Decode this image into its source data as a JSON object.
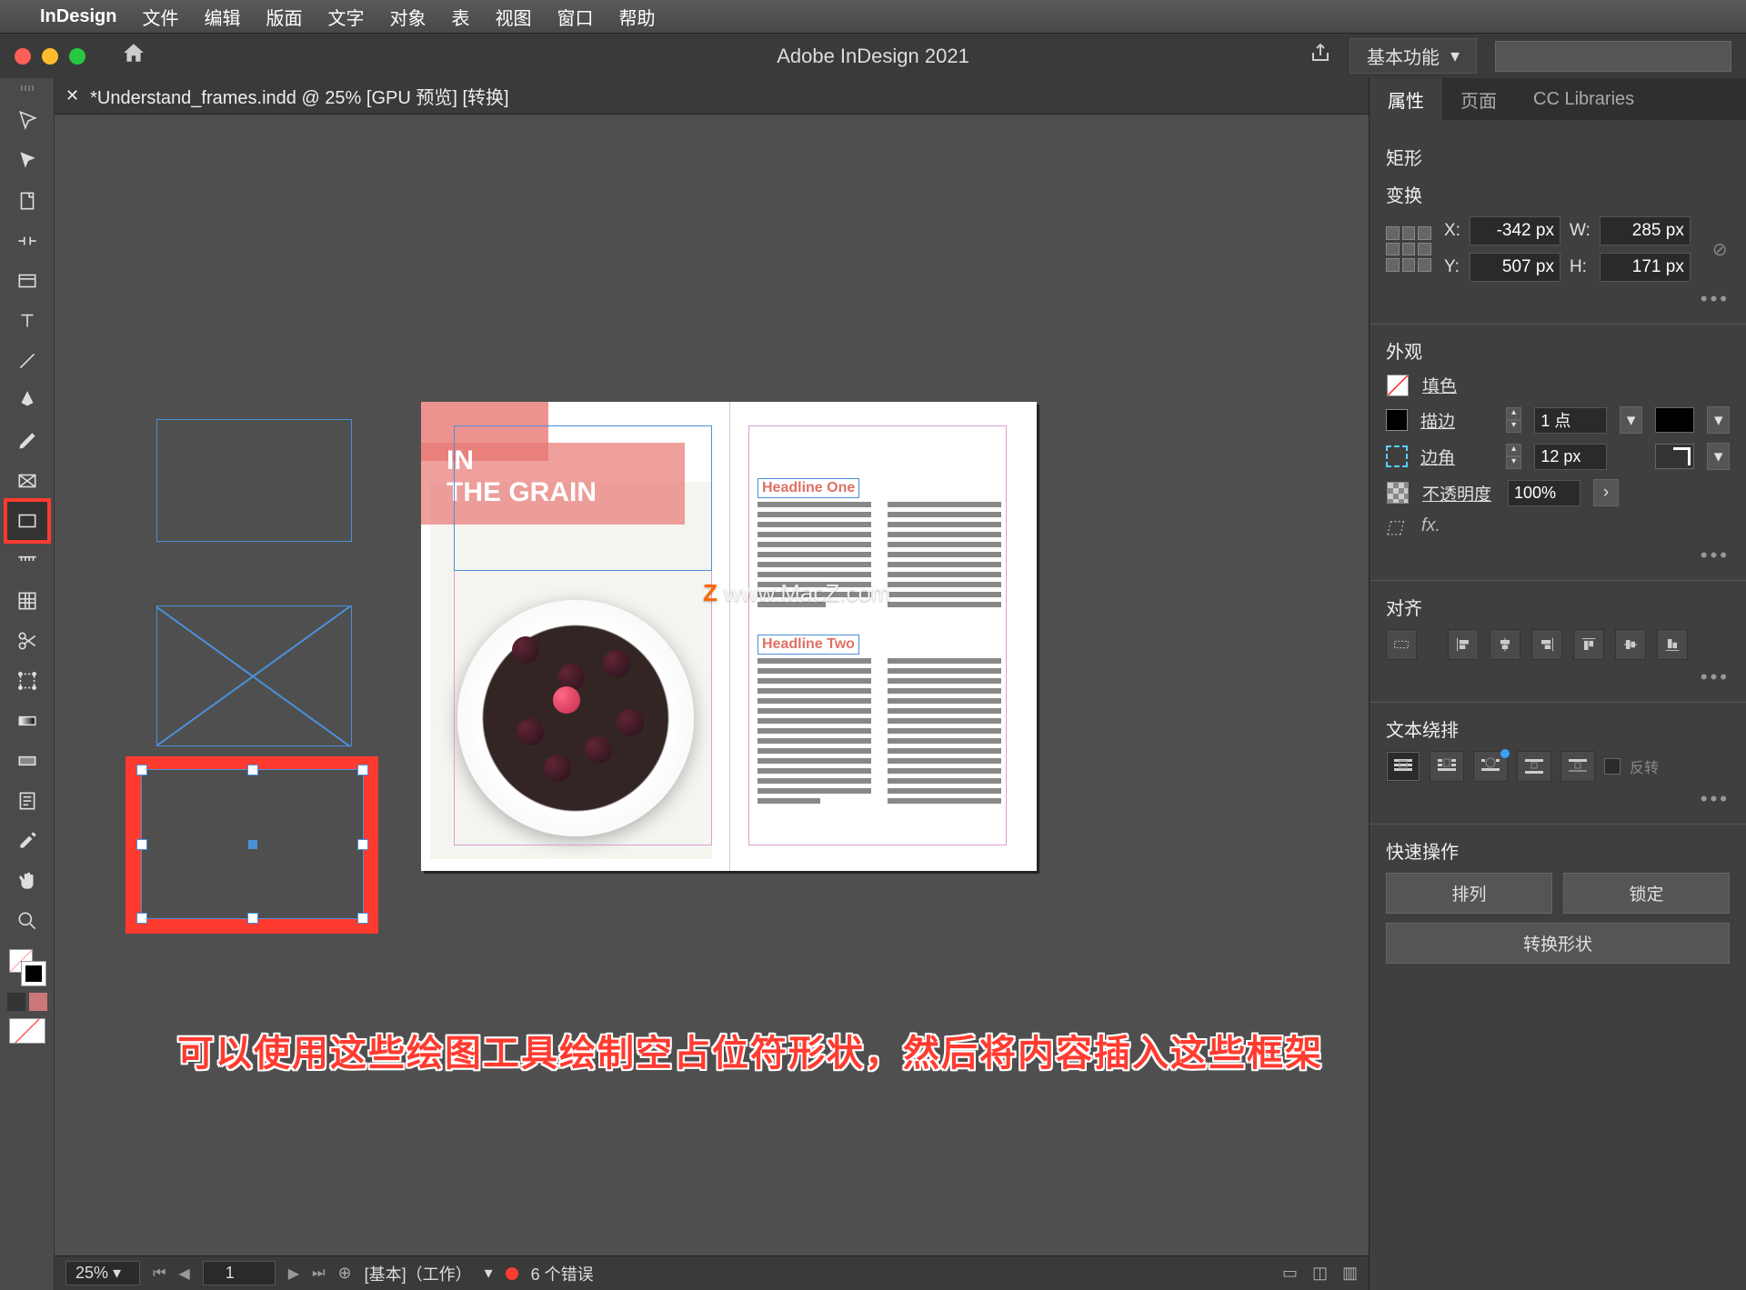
{
  "menubar": {
    "app": "InDesign",
    "items": [
      "文件",
      "编辑",
      "版面",
      "文字",
      "对象",
      "表",
      "视图",
      "窗口",
      "帮助"
    ]
  },
  "titlebar": {
    "title": "Adobe InDesign 2021",
    "workspace": "基本功能"
  },
  "tab": {
    "label": "*Understand_frames.indd @ 25% [GPU 预览] [转换]"
  },
  "document": {
    "grain_line1": "IN",
    "grain_line2": "THE GRAIN",
    "headline1": "Headline One",
    "headline2": "Headline Two",
    "watermark": "www.MacZ.com"
  },
  "annotation": "可以使用这些绘图工具绘制空占位符形状，然后将内容插入这些框架",
  "status": {
    "zoom": "25%",
    "page": "1",
    "layer": "[基本]（工作）",
    "errors": "6 个错误"
  },
  "panel": {
    "tabs": [
      "属性",
      "页面",
      "CC Libraries"
    ],
    "selection": "矩形",
    "transform": {
      "title": "变换",
      "x_label": "X:",
      "x": "-342 px",
      "y_label": "Y:",
      "y": "507 px",
      "w_label": "W:",
      "w": "285 px",
      "h_label": "H:",
      "h": "171 px"
    },
    "appearance": {
      "title": "外观",
      "fill": "填色",
      "stroke": "描边",
      "stroke_val": "1 点",
      "corner": "边角",
      "corner_val": "12 px",
      "opacity": "不透明度",
      "opacity_val": "100%",
      "fx": "fx."
    },
    "align": {
      "title": "对齐"
    },
    "wrap": {
      "title": "文本绕排",
      "invert": "反转"
    },
    "quick": {
      "title": "快速操作",
      "arrange": "排列",
      "lock": "锁定",
      "convert": "转换形状"
    }
  }
}
